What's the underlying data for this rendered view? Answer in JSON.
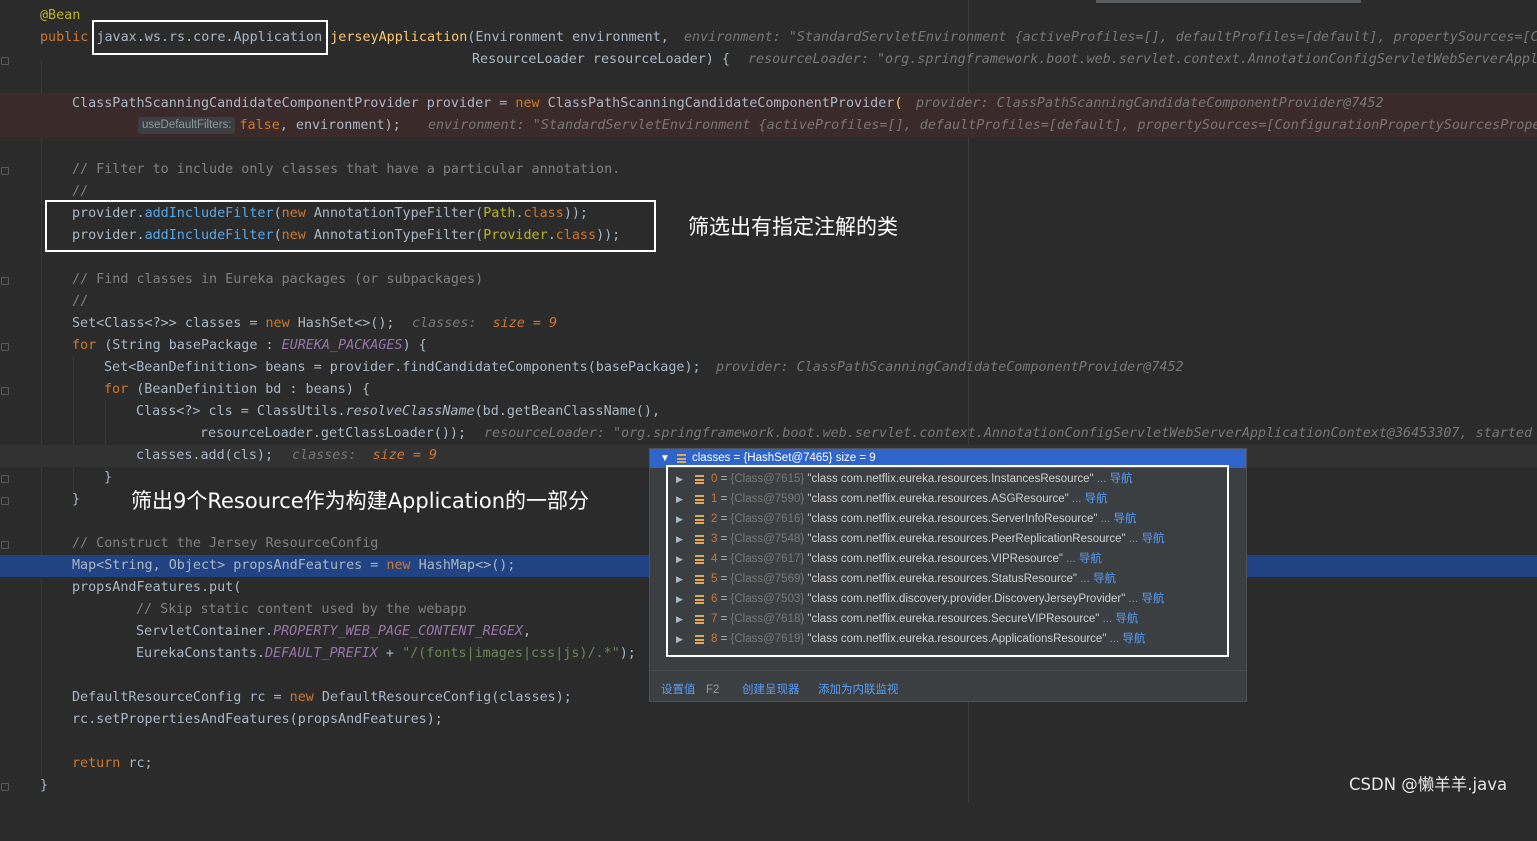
{
  "code": {
    "l1": {
      "ann": "@Bean"
    },
    "l2": {
      "kw": "public ",
      "type": "javax.ws.rs.core.Application",
      "fn": "jerseyApplication",
      "rest": "(Environment environment,",
      "hint": "environment: \"StandardServletEnvironment {activeProfiles=[], defaultProfiles=[default], propertySources=[Co"
    },
    "l3": {
      "rest": "ResourceLoader resourceLoader) {",
      "hint": "resourceLoader: \"org.springframework.boot.web.servlet.context.AnnotationConfigServletWebServerAppli"
    },
    "l5": {
      "a": "ClassPathScanningCandidateComponentProvider provider = ",
      "kw": "new ",
      "b": "ClassPathScanningCandidateComponentProvider",
      "c": "(",
      "hint": "provider: ClassPathScanningCandidateComponentProvider@7452"
    },
    "l6": {
      "inlay": "useDefaultFilters:",
      "kw": "false",
      "rest": ", environment);",
      "hint": "environment: \"StandardServletEnvironment {activeProfiles=[], defaultProfiles=[default], propertySources=[ConfigurationPropertySourcesProper"
    },
    "l8": {
      "cmt": "// Filter to include only classes that have a particular annotation."
    },
    "l9": {
      "cmt": "//"
    },
    "l10": {
      "a": "provider.",
      "m": "addIncludeFilter",
      "b": "(",
      "kw": "new ",
      "c": "AnnotationTypeFilter(",
      "d": "Path",
      "e": ".",
      "k2": "class",
      "f": "));"
    },
    "l11": {
      "a": "provider.",
      "m": "addIncludeFilter",
      "b": "(",
      "kw": "new ",
      "c": "AnnotationTypeFilter(",
      "d": "Provider",
      "e": ".",
      "k2": "class",
      "f": "));"
    },
    "l13": {
      "cmt": "// Find classes in Eureka packages (or subpackages)"
    },
    "l14": {
      "cmt": "//"
    },
    "l15": {
      "a": "Set<Class<?>> classes = ",
      "kw": "new ",
      "b": "HashSet<>();",
      "h1": "classes:",
      "h2": "size = 9"
    },
    "l16": {
      "kw": "for ",
      "a": "(String basePackage : ",
      "st": "EUREKA_PACKAGES",
      "b": ") {"
    },
    "l17": {
      "a": "Set<BeanDefinition> beans = provider.findCandidateComponents(basePackage);",
      "hint": "provider: ClassPathScanningCandidateComponentProvider@7452"
    },
    "l18": {
      "kw": "for ",
      "a": "(BeanDefinition bd : beans) {"
    },
    "l19": {
      "a": "Class<?> cls = ClassUtils.",
      "it": "resolveClassName",
      "b": "(bd.getBeanClassName(),"
    },
    "l20": {
      "a": "resourceLoader.getClassLoader());",
      "hint": "resourceLoader: \"org.springframework.boot.web.servlet.context.AnnotationConfigServletWebServerApplicationContext@36453307, started o"
    },
    "l21": {
      "a": "classes.add(cls);",
      "h1": "classes:",
      "h2": "size = 9"
    },
    "l22": {
      "a": "}"
    },
    "l23": {
      "a": "}"
    },
    "l25": {
      "cmt": "// Construct the Jersey ResourceConfig"
    },
    "l26": {
      "a": "Map<String, Object> propsAndFeatures = ",
      "kw": "new ",
      "b": "HashMap<>();"
    },
    "l27": {
      "a": "propsAndFeatures.put("
    },
    "l28": {
      "cmt": "// Skip static content used by the webapp"
    },
    "l29": {
      "a": "ServletContainer.",
      "st": "PROPERTY_WEB_PAGE_CONTENT_REGEX",
      "b": ","
    },
    "l30": {
      "a": "EurekaConstants.",
      "st": "DEFAULT_PREFIX",
      "b": " + ",
      "str": "\"/(fonts|images|css|js)/.*\"",
      "c": ");"
    },
    "l32": {
      "a": "DefaultResourceConfig rc = ",
      "kw": "new ",
      "b": "DefaultResourceConfig(classes);"
    },
    "l33": {
      "a": "rc.setPropertiesAndFeatures(propsAndFeatures);"
    },
    "l35": {
      "kw": "return ",
      "a": "rc;"
    },
    "l36": {
      "a": "}"
    }
  },
  "annotations": {
    "filter_note": "筛选出有指定注解的类",
    "resource_note": "筛出9个Resource作为构建Application的一部分"
  },
  "popup": {
    "header": "classes = {HashSet@7465}  size = 9",
    "rows": [
      {
        "idx": "0",
        "ref": "{Class@7615}",
        "val": "\"class com.netflix.eureka.resources.InstancesResource\"",
        "nav": "... 导航"
      },
      {
        "idx": "1",
        "ref": "{Class@7590}",
        "val": "\"class com.netflix.eureka.resources.ASGResource\"",
        "nav": "... 导航"
      },
      {
        "idx": "2",
        "ref": "{Class@7616}",
        "val": "\"class com.netflix.eureka.resources.ServerInfoResource\"",
        "nav": "... 导航"
      },
      {
        "idx": "3",
        "ref": "{Class@7548}",
        "val": "\"class com.netflix.eureka.resources.PeerReplicationResource\"",
        "nav": "... 导航"
      },
      {
        "idx": "4",
        "ref": "{Class@7617}",
        "val": "\"class com.netflix.eureka.resources.VIPResource\"",
        "nav": "... 导航"
      },
      {
        "idx": "5",
        "ref": "{Class@7569}",
        "val": "\"class com.netflix.eureka.resources.StatusResource\"",
        "nav": "... 导航"
      },
      {
        "idx": "6",
        "ref": "{Class@7503}",
        "val": "\"class com.netflix.discovery.provider.DiscoveryJerseyProvider\"",
        "nav": "... 导航"
      },
      {
        "idx": "7",
        "ref": "{Class@7618}",
        "val": "\"class com.netflix.eureka.resources.SecureVIPResource\"",
        "nav": "... 导航"
      },
      {
        "idx": "8",
        "ref": "{Class@7619}",
        "val": "\"class com.netflix.eureka.resources.ApplicationsResource\"",
        "nav": "... 导航"
      }
    ],
    "footer": {
      "set_value": "设置值",
      "shortcut": "F2",
      "create_renderer": "创建呈现器",
      "add_inline_watch": "添加为内联监视"
    }
  },
  "watermark": "CSDN @懒羊羊.java",
  "colors": {
    "keyword": "#cc7832",
    "method": "#ffc66d",
    "comment": "#808080",
    "string": "#6a8759",
    "static_field": "#9876aa",
    "selection": "#214283",
    "popup_header": "#2f65ca",
    "link": "#589df6"
  }
}
